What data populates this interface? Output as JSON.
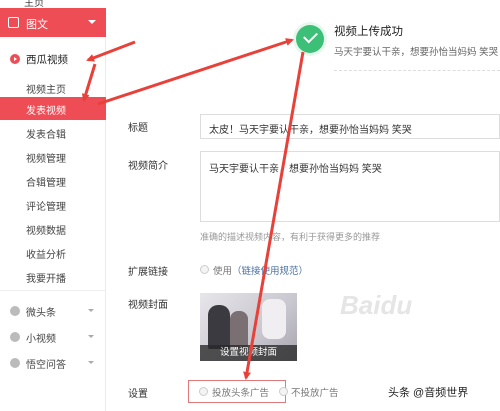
{
  "sidebar": {
    "top_partial": "主页",
    "category": "图文",
    "section": "西瓜视频",
    "items": [
      "视频主页",
      "发表视频",
      "发表合辑",
      "视频管理",
      "合辑管理",
      "评论管理",
      "视频数据",
      "收益分析",
      "我要开播"
    ],
    "active_item": "发表视频",
    "groups": [
      "微头条",
      "小视频",
      "悟空问答"
    ]
  },
  "upload_status": {
    "title": "视频上传成功",
    "subtitle": "马天宇要认干亲，想要孙怡当妈妈 笑哭"
  },
  "form": {
    "title_label": "标题",
    "title_value": "太皮！马天宇要认干亲，想要孙怡当妈妈 笑哭",
    "desc_label": "视频简介",
    "desc_value": "马天宇要认干亲，想要孙怡当妈妈 笑哭",
    "desc_hint": "准确的描述视频内容，有利于获得更多的推荐",
    "ext_label": "扩展链接",
    "ext_option": "使用",
    "ext_link": "（链接使用规范）",
    "cover_label": "视频封面",
    "cover_button": "设置视频封面",
    "setting_label": "设置",
    "setting_opt1": "投放头条广告",
    "setting_opt2": "不投放广告"
  },
  "watermark": "头条 @音频世界",
  "baidu_watermark": "Baidu",
  "colors": {
    "accent": "#ee4d55",
    "success": "#3cbf76",
    "annotation": "#e8413a"
  }
}
